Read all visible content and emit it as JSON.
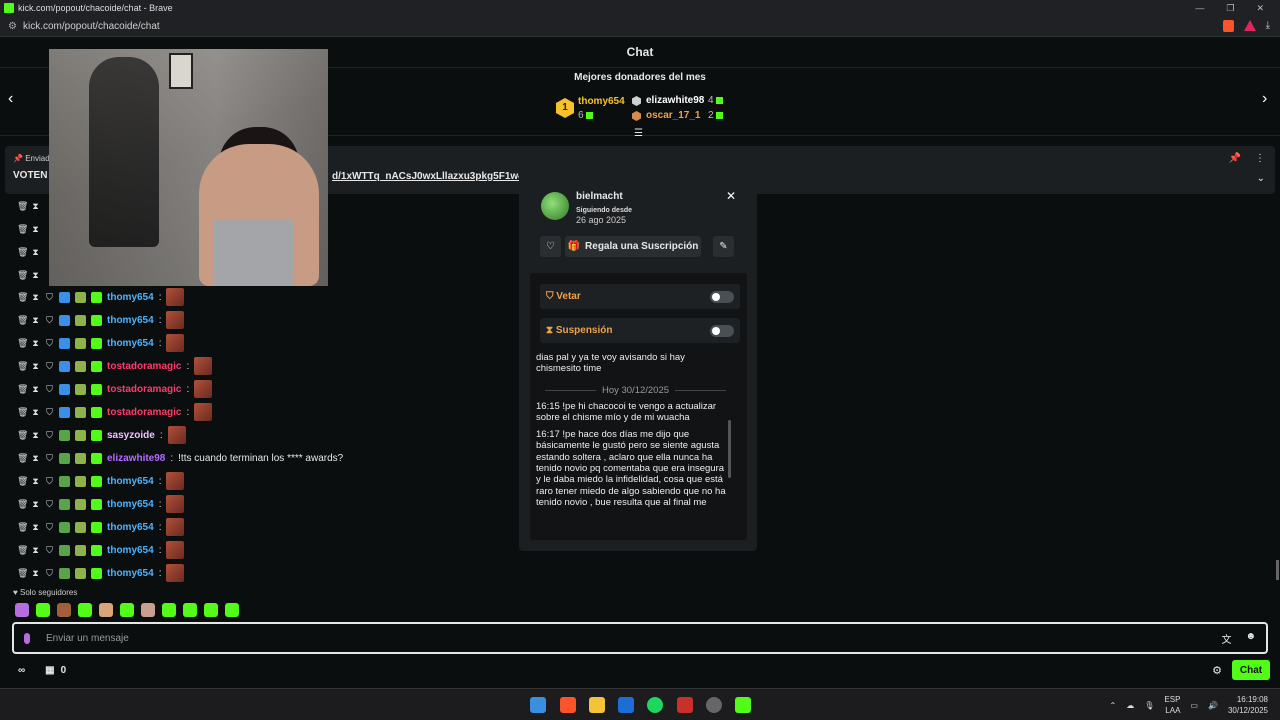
{
  "browser": {
    "title": "kick.com/popout/chacoide/chat - Brave",
    "url": "kick.com/popout/chacoide/chat"
  },
  "header": {
    "title": "Chat"
  },
  "donors": {
    "title": "Mejores donadores del mes",
    "first": {
      "rank": "1",
      "name": "thomy654",
      "count": "6"
    },
    "second": {
      "name": "elizawhite98",
      "count": "4"
    },
    "third": {
      "name": "oscar_17_1",
      "count": "2"
    }
  },
  "pinned": {
    "label": "Enviad",
    "message": "VOTEN P",
    "link": "d/1xWTTq_nACsJ0wxLllazxu3pkg5F1w4bA"
  },
  "chat": [
    {
      "user": "thomy654",
      "suffix": ":",
      "color": "#4db3ff",
      "text": ""
    },
    {
      "user": "thomy654",
      "suffix": ":",
      "color": "#4db3ff",
      "text": ""
    },
    {
      "user": "thomy654",
      "suffix": ":",
      "color": "#4db3ff",
      "text": ""
    },
    {
      "user": "tostadoramagic",
      "suffix": ":",
      "color": "#ff3b6b",
      "text": ""
    },
    {
      "user": "tostadoramagic",
      "suffix": ":",
      "color": "#ff3b6b",
      "text": ""
    },
    {
      "user": "tostadoramagic",
      "suffix": ":",
      "color": "#ff3b6b",
      "text": ""
    },
    {
      "user": "sasyzoide",
      "suffix": ":",
      "color": "#f2c2ff",
      "text": ""
    },
    {
      "user": "elizawhite98",
      "suffix": ":",
      "color": "#b36bff",
      "text": "!tts cuando terminan los **** awards?"
    },
    {
      "user": "thomy654",
      "suffix": ":",
      "color": "#4db3ff",
      "text": ""
    },
    {
      "user": "thomy654",
      "suffix": ":",
      "color": "#4db3ff",
      "text": ""
    },
    {
      "user": "thomy654",
      "suffix": ":",
      "color": "#4db3ff",
      "text": ""
    },
    {
      "user": "thomy654",
      "suffix": ":",
      "color": "#4db3ff",
      "text": ""
    },
    {
      "user": "thomy654",
      "suffix": ":",
      "color": "#4db3ff",
      "text": ""
    }
  ],
  "overlap_rows": [
    {
      "user": "thomy654:",
      "partial": "oramagic:"
    },
    {
      "user": "thomy654:",
      "partial": "oramagic:"
    },
    {
      "user": "thomy654:",
      "partial": "tostadoramagic:"
    }
  ],
  "usercard": {
    "username": "bielmacht",
    "following_label": "Siguiendo desde",
    "following_date": "26 ago 2025",
    "gift_label": "Regala una Suscripción",
    "ban_label": "Vetar",
    "timeout_label": "Suspensión",
    "history_top": "dias pal y ya te voy avisando si hay chismesito time",
    "separator": "Hoy 30/12/2025",
    "messages": [
      "16:15 !pe hi chacocoi te vengo a actualizar sobre el chisme mío y de mi wuacha",
      "16:17 !pe hace dos días me dijo que básicamente le gustó pero se siente agusta estando soltera , aclaro que ella nunca ha tenido novio pq comentaba que era insegura y le daba miedo la infidelidad, cosa que está raro tener miedo de algo sabiendo que no ha tenido novio , bue resulta que al final me"
    ]
  },
  "bottom": {
    "followers_only": "Solo seguidores",
    "input_placeholder": "Enviar un mensaje",
    "count": "0",
    "chat_button": "Chat"
  },
  "taskbar": {
    "lang1": "ESP",
    "lang2": "LAA",
    "time": "16:19:08",
    "date": "30/12/2025"
  },
  "colors": {
    "kick_green": "#53fc18",
    "ban_orange": "#f0a24a"
  }
}
